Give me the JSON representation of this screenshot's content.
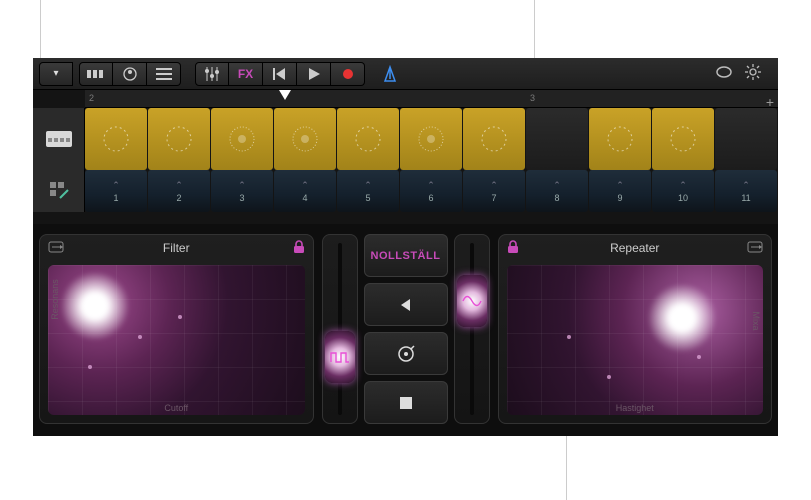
{
  "toolbar": {
    "fx_label": "FX"
  },
  "ruler": {
    "mark2": "2",
    "mark3": "3"
  },
  "steps": [
    "1",
    "2",
    "3",
    "4",
    "5",
    "6",
    "7",
    "8",
    "9",
    "10",
    "11"
  ],
  "center": {
    "reset_label": "NOLLSTÄLL"
  },
  "left_pad": {
    "title": "Filter",
    "y_axis": "Resonans",
    "x_axis": "Cutoff"
  },
  "right_pad": {
    "title": "Repeater",
    "y_axis": "Mixa",
    "x_axis": "Hastighet"
  },
  "colors": {
    "accent": "#c84bb9",
    "cell_on": "#b7921f",
    "metronome": "#3d8ef0"
  }
}
